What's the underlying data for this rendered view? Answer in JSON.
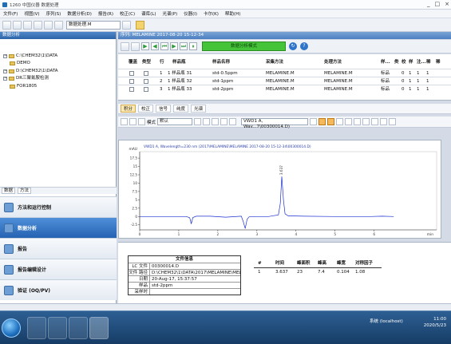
{
  "window": {
    "title": "1260 中国仪器 数据处理",
    "controls": [
      "_",
      "□",
      "×"
    ]
  },
  "menu": [
    "文件(F)",
    "视图(V)",
    "序列(S)",
    "数据分析(D)",
    "报告(R)",
    "校正(C)",
    "谱库(L)",
    "光谱(P)",
    "仪器(I)",
    "卡尔(K)",
    "帮助(H)"
  ],
  "toolbar": {
    "method_combo": "数据处理.M"
  },
  "left_panel": {
    "header": "数据分析",
    "tree": [
      {
        "label": "C:\\CHEM32\\1\\DATA",
        "level": 0,
        "expander": "−"
      },
      {
        "label": "DEMO",
        "level": 1,
        "expander": ""
      },
      {
        "label": "D:\\CHEM32\\1\\DATA",
        "level": 0,
        "expander": "−"
      },
      {
        "label": "DR三聚氰胺检测",
        "level": 0,
        "expander": "−"
      },
      {
        "label": "FOR1805",
        "level": 1,
        "expander": ""
      }
    ],
    "tabs": [
      "数据",
      "方法"
    ],
    "nav": [
      {
        "label": "方法和运行控制",
        "active": false
      },
      {
        "label": "数据分析",
        "active": true
      },
      {
        "label": "报告",
        "active": false
      },
      {
        "label": "报告编辑设计",
        "active": false
      },
      {
        "label": "验证 (OQ/PV)",
        "active": false
      }
    ]
  },
  "main": {
    "tab_title": "序列: MELAMINE 2017-08-20 15-12-34",
    "seq_status": "数据分析模式",
    "seq_table": {
      "headers": [
        "覆盖",
        "类型",
        "行",
        "样品瓶",
        "样品名称",
        "采集方法",
        "处理方法",
        "样...",
        "类",
        "校",
        "样",
        "注...",
        "稀",
        "稀"
      ],
      "rows": [
        {
          "row": "1",
          "vial": "1 样品瓶 31",
          "name": "std-0.5ppm",
          "acq": "MELAMINE.M",
          "proc": "MELAMINE.M",
          "samp": "标品",
          "c1": "",
          "c2": "0",
          "c3": "1",
          "c4": "1",
          "c5": "1"
        },
        {
          "row": "2",
          "vial": "1 样品瓶 32",
          "name": "std-1ppm",
          "acq": "MELAMINE.M",
          "proc": "MELAMINE.M",
          "samp": "标品",
          "c1": "",
          "c2": "0",
          "c3": "1",
          "c4": "1",
          "c5": "1"
        },
        {
          "row": "3",
          "vial": "1 样品瓶 33",
          "name": "std-2ppm",
          "acq": "MELAMINE.M",
          "proc": "MELAMINE.M",
          "samp": "标品",
          "c1": "",
          "c2": "0",
          "c3": "1",
          "c4": "1",
          "c5": "1"
        }
      ]
    },
    "subtabs": [
      "积分",
      "校正",
      "信号",
      "纯度",
      "光谱"
    ],
    "data_toolbar": {
      "mode_label": "模式",
      "mode_value": "默认",
      "signal_combo": "VWD1 A, Wav...7\\00300014.D)"
    },
    "chart_caption": "VWD1 A, Wavelength=230 nm (2017\\MELAMINE\\MELAMINE 2017-08-20 15-12-34\\00300014.D)",
    "chart_unit_y": "mAU",
    "chart_unit_x": "min",
    "peak_label": "3.637",
    "file_info": {
      "title": "文件信息",
      "rows": [
        {
          "k": "LC 文件",
          "v": "00300014.D"
        },
        {
          "k": "文件 路径",
          "v": "D:\\CHEM32\\1\\DATA\\2017\\MELAMINE\\MELAMINE 20"
        },
        {
          "k": "日期",
          "v": "20-Aug-17, 15:37:57"
        },
        {
          "k": "样品",
          "v": "std-2ppm"
        },
        {
          "k": "采样时",
          "v": ""
        }
      ]
    },
    "peak_table": {
      "headers": [
        "#",
        "时间",
        "峰面积",
        "峰高",
        "峰宽",
        "对称因子"
      ],
      "rows": [
        [
          "1",
          "3.637",
          "23",
          "7.4",
          "0.104",
          "1.08"
        ]
      ]
    }
  },
  "chart_data": {
    "type": "line",
    "title": "",
    "xlabel": "min",
    "ylabel": "mAU",
    "x_ticks": [
      "0",
      "1",
      "2",
      "3",
      "4",
      "5",
      "6"
    ],
    "y_ticks": [
      "17.5",
      "15",
      "12.5",
      "10",
      "7.5",
      "5",
      "2.5",
      "0",
      "-2.5"
    ],
    "xlim": [
      0,
      7.6
    ],
    "ylim": [
      -4,
      18
    ],
    "series": [
      {
        "x": [
          0,
          1.2,
          1.28,
          1.32,
          1.36,
          1.45,
          1.8,
          2.2,
          2.6,
          2.65,
          2.7,
          2.75,
          2.8,
          3.0,
          3.3,
          3.55,
          3.6,
          3.637,
          3.68,
          3.72,
          3.8,
          4.2,
          5.0,
          5.9,
          6.2,
          6.5
        ],
        "y": [
          0,
          0,
          -0.4,
          -2.2,
          -0.3,
          0.1,
          0.1,
          -0.2,
          0.1,
          -1.5,
          -3.6,
          -0.8,
          -0.1,
          0,
          0,
          0.5,
          4.0,
          12.0,
          5.0,
          0.8,
          0.2,
          0.1,
          0,
          0,
          0.1,
          0
        ]
      }
    ],
    "annotations": [
      {
        "x": 3.637,
        "text": "3.637"
      }
    ]
  },
  "taskbar": {
    "status": "系统 (localhost)",
    "time": "11:00",
    "date": "2020/5/23"
  }
}
